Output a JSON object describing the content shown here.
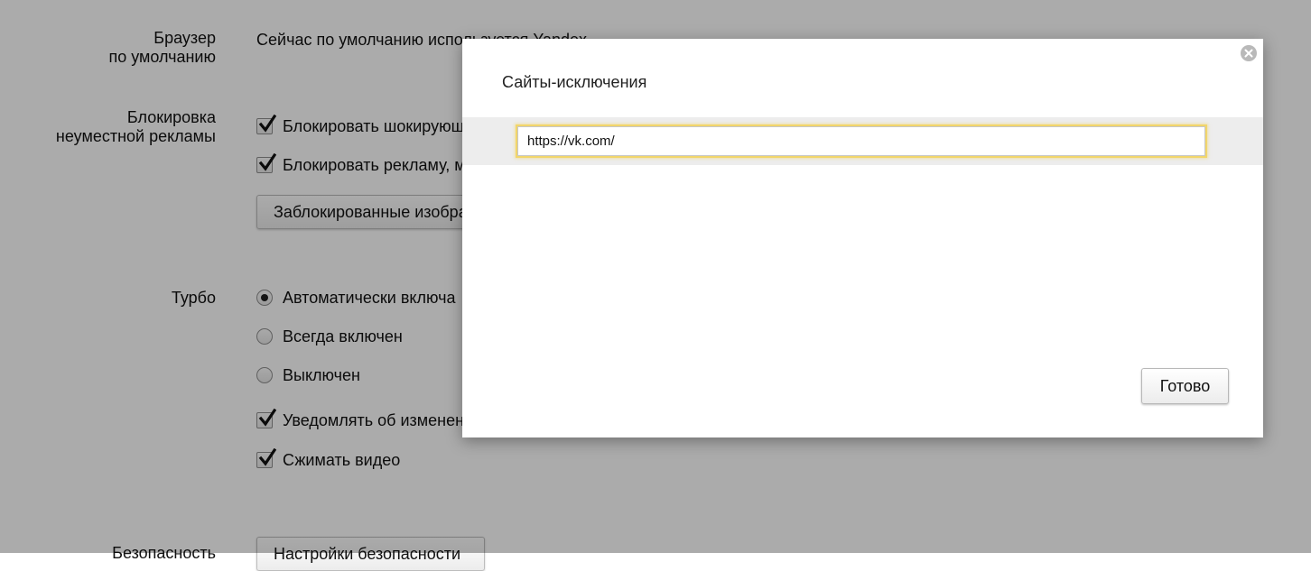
{
  "settings": {
    "default_browser": {
      "label": "Браузер\nпо умолчанию",
      "status": "Сейчас по умолчанию используется Yandex"
    },
    "ad_blocking": {
      "label": "Блокировка\nнеуместной рекламы",
      "options": [
        {
          "label": "Блокировать шокирующую",
          "checked": true
        },
        {
          "label": "Блокировать рекламу, м",
          "checked": true
        }
      ],
      "blocked_images_button": "Заблокированные изображения"
    },
    "turbo": {
      "label": "Турбо",
      "radios": [
        {
          "label": "Автоматически включа",
          "selected": true
        },
        {
          "label": "Всегда включен",
          "selected": false
        },
        {
          "label": "Выключен",
          "selected": false
        }
      ],
      "checks": [
        {
          "label": "Уведомлять об изменении",
          "checked": true
        },
        {
          "label": "Сжимать видео",
          "checked": true
        }
      ]
    },
    "security": {
      "label": "Безопасность",
      "button": "Настройки безопасности"
    }
  },
  "dialog": {
    "title": "Сайты-исключения",
    "url_value": "https://vk.com/",
    "done_label": "Готово",
    "close_icon": "close-icon"
  },
  "colors": {
    "overlay": "rgba(0,0,0,0.33)",
    "focus_ring": "#f2d66b",
    "row_bg": "#ededed"
  }
}
